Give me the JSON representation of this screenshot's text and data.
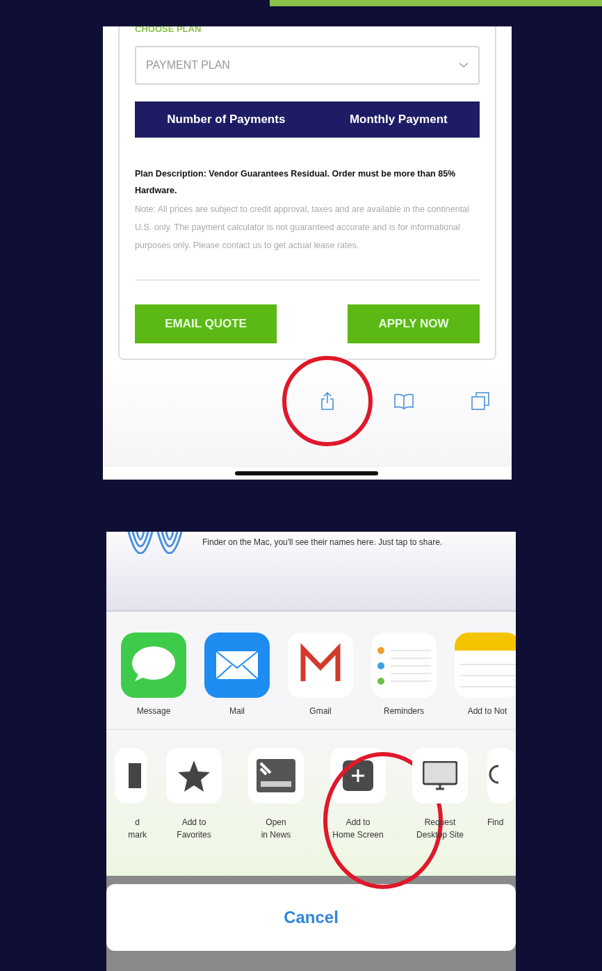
{
  "top_screen": {
    "section_title": "CHOOSE PLAN",
    "plan_select": {
      "placeholder": "PAYMENT PLAN"
    },
    "table_header": [
      "Number of Payments",
      "Monthly Payment"
    ],
    "description": {
      "title": "Plan Description: Vendor Guarantees Residual. Order must be more than 85% Hardware.",
      "note": "Note: All prices are subject to credit approval, taxes and are available in the continental U.S. only. The payment calculator is not guaranteed accurate and is for informational purposes only. Please contact us to get actual lease rates."
    },
    "buttons": [
      "EMAIL QUOTE",
      "APPLY NOW"
    ],
    "toolbar": [
      {
        "kind": "share",
        "highlighted": true
      },
      {
        "kind": "bookmarks",
        "highlighted": false
      },
      {
        "kind": "tabs",
        "highlighted": false
      }
    ]
  },
  "bottom_screen": {
    "airdrop_text": "Finder on the Mac, you'll see their names here. Just tap to share.",
    "apps": [
      {
        "kind": "message",
        "label": "Message"
      },
      {
        "kind": "mail",
        "label": "Mail"
      },
      {
        "kind": "gmail",
        "label": "Gmail"
      },
      {
        "kind": "reminders",
        "label": "Reminders"
      },
      {
        "kind": "notes",
        "label": "Add to Not"
      }
    ],
    "actions": [
      {
        "kind": "bookmark",
        "lines": [
          "d",
          "mark"
        ],
        "highlighted": false
      },
      {
        "kind": "favorites",
        "lines": [
          "Add to",
          "Favorites"
        ],
        "highlighted": false
      },
      {
        "kind": "news",
        "lines": [
          "Open",
          "in News"
        ],
        "highlighted": false
      },
      {
        "kind": "home",
        "lines": [
          "Add to",
          "Home Screen"
        ],
        "highlighted": true
      },
      {
        "kind": "desktop",
        "lines": [
          "Request",
          "Desktop Site"
        ],
        "highlighted": false
      },
      {
        "kind": "find",
        "lines": [
          "Find"
        ],
        "highlighted": false
      }
    ],
    "cancel": "Cancel"
  }
}
